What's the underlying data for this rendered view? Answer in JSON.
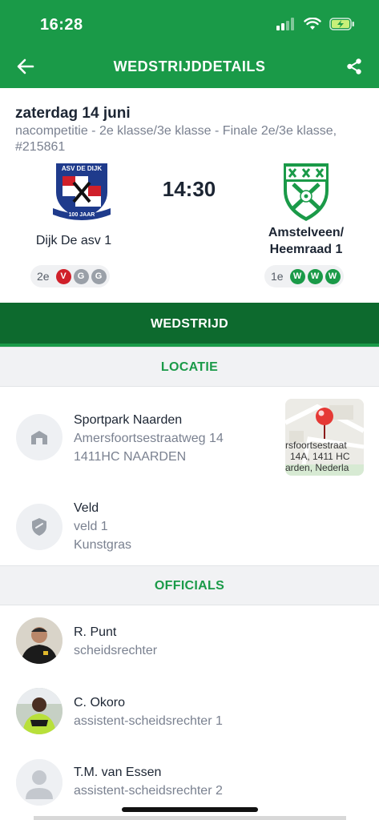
{
  "status_bar": {
    "time": "16:28"
  },
  "app_bar": {
    "title": "WEDSTRIJDDETAILS"
  },
  "match": {
    "date": "zaterdag 14 juni",
    "competition": "nacompetitie - 2e klasse/3e klasse - Finale 2e/3e klasse, #215861",
    "kickoff": "14:30",
    "home": {
      "name": "Dijk De asv 1",
      "logo_text_top": "ASV DE DIJK",
      "logo_text_bottom": "100 JAAR",
      "rank": "2e",
      "form": [
        {
          "result": "V",
          "color": "#d0202a"
        },
        {
          "result": "G",
          "color": "#9aa0a8"
        },
        {
          "result": "G",
          "color": "#9aa0a8"
        }
      ]
    },
    "away": {
      "name": "Amstelveen/ Heemraad 1",
      "rank": "1e",
      "form": [
        {
          "result": "W",
          "color": "#1a9a48"
        },
        {
          "result": "W",
          "color": "#1a9a48"
        },
        {
          "result": "W",
          "color": "#1a9a48"
        }
      ]
    }
  },
  "tab": {
    "label": "WEDSTRIJD"
  },
  "location": {
    "section_title": "LOCATIE",
    "venue": {
      "name": "Sportpark Naarden",
      "street": "Amersfoortsestraatweg 14",
      "city": "1411HC NAARDEN",
      "icon": "building-icon"
    },
    "map_label_1": "rsfoortsestraat",
    "map_label_2": "14A, 1411 HC",
    "map_label_3": "arden, Nederla",
    "field": {
      "title": "Veld",
      "name": "veld 1",
      "surface": "Kunstgras",
      "icon": "shield-icon"
    }
  },
  "officials": {
    "section_title": "OFFICIALS",
    "list": [
      {
        "name": "R. Punt",
        "role": "scheidsrechter"
      },
      {
        "name": "C. Okoro",
        "role": "assistent-scheidsrechter 1"
      },
      {
        "name": "T.M. van Essen",
        "role": "assistent-scheidsrechter 2"
      }
    ]
  },
  "colors": {
    "brand_green": "#1a9a48",
    "dark_green": "#0d6a2e",
    "loss_red": "#d0202a",
    "draw_grey": "#9aa0a8"
  }
}
